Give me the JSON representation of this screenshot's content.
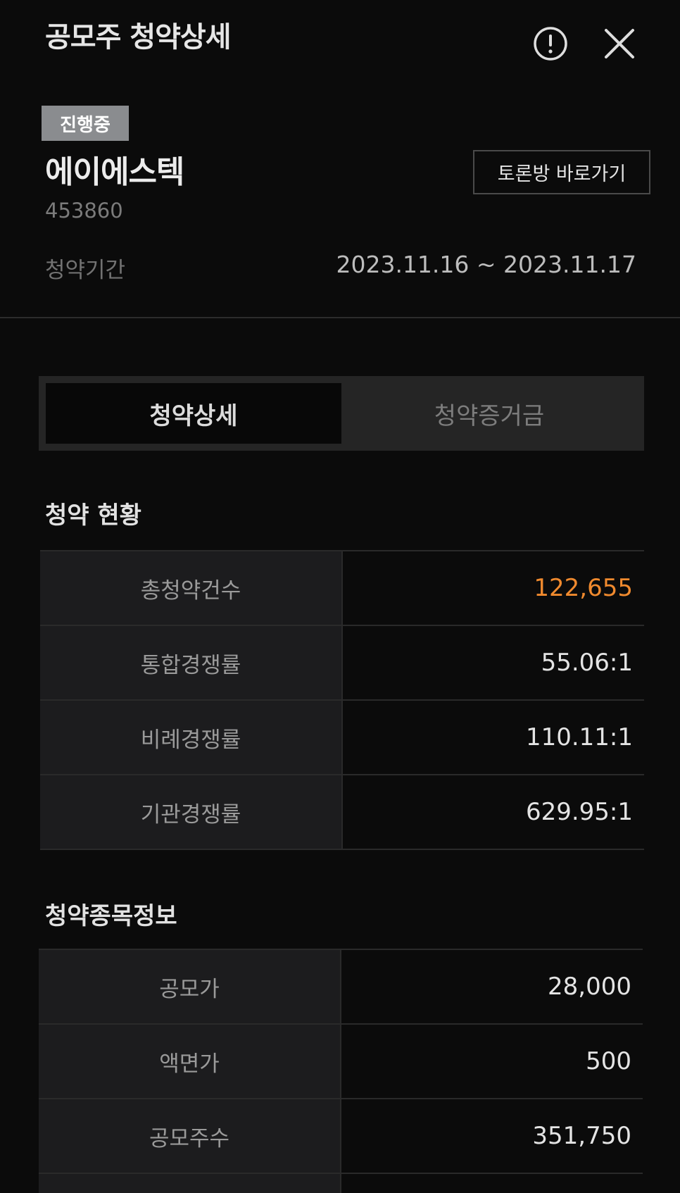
{
  "header": {
    "title": "공모주 청약상세"
  },
  "stock": {
    "status": "진행중",
    "name": "에이에스텍",
    "code": "453860",
    "forum_button": "토론방 바로가기",
    "period_label": "청약기간",
    "period_value": "2023.11.16 ~ 2023.11.17"
  },
  "tabs": [
    {
      "label": "청약상세",
      "active": true
    },
    {
      "label": "청약증거금",
      "active": false
    }
  ],
  "subscription_status": {
    "title": "청약 현황",
    "rows": [
      {
        "label": "총청약건수",
        "value": "122,655"
      },
      {
        "label": "통합경쟁률",
        "value": "55.06:1"
      },
      {
        "label": "비례경쟁률",
        "value": "110.11:1"
      },
      {
        "label": "기관경쟁률",
        "value": "629.95:1"
      }
    ]
  },
  "stock_info": {
    "title": "청약종목정보",
    "rows": [
      {
        "label": "공모가",
        "value": "28,000"
      },
      {
        "label": "액면가",
        "value": "500"
      },
      {
        "label": "공모주수",
        "value": "351,750"
      },
      {
        "label": "",
        "value": ""
      }
    ]
  },
  "colors": {
    "background": "#0b0b0b",
    "accent": "#f08a2e",
    "badge": "#8a8c8f"
  },
  "icons": {
    "info": "exclamation-circle-icon",
    "close": "close-icon"
  }
}
